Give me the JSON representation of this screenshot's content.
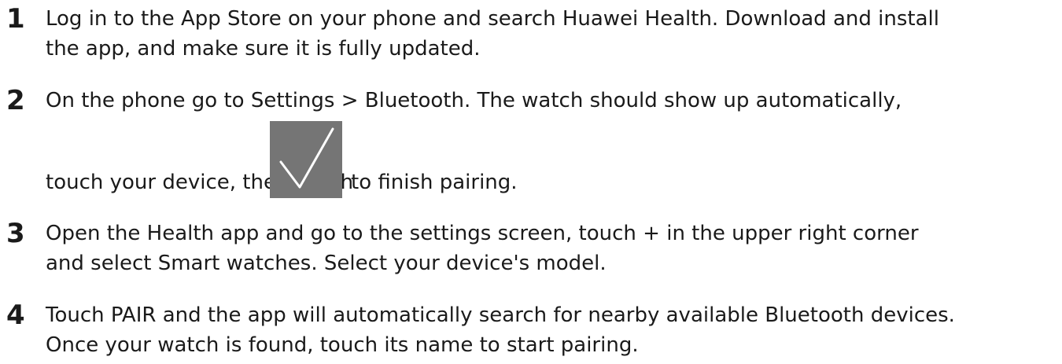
{
  "steps": [
    {
      "number": "1",
      "lines": [
        "Log in to the App Store on your phone and search Huawei Health. Download and install",
        "the app, and make sure it is fully updated."
      ]
    },
    {
      "number": "2",
      "line1": "On the phone go to Settings > Bluetooth. The watch should show up automatically,",
      "line2_before": "touch your device, then touch",
      "line2_after": "to finish pairing.",
      "icon": "checkmark-icon",
      "icon_color": "#757575"
    },
    {
      "number": "3",
      "lines": [
        "Open the Health app and go to the settings screen, touch + in the upper right corner",
        "and select Smart watches. Select your device's model."
      ]
    },
    {
      "number": "4",
      "lines": [
        "Touch PAIR and the app will automatically search for nearby available Bluetooth devices.",
        "Once your watch is found, touch its name to start pairing."
      ]
    }
  ]
}
